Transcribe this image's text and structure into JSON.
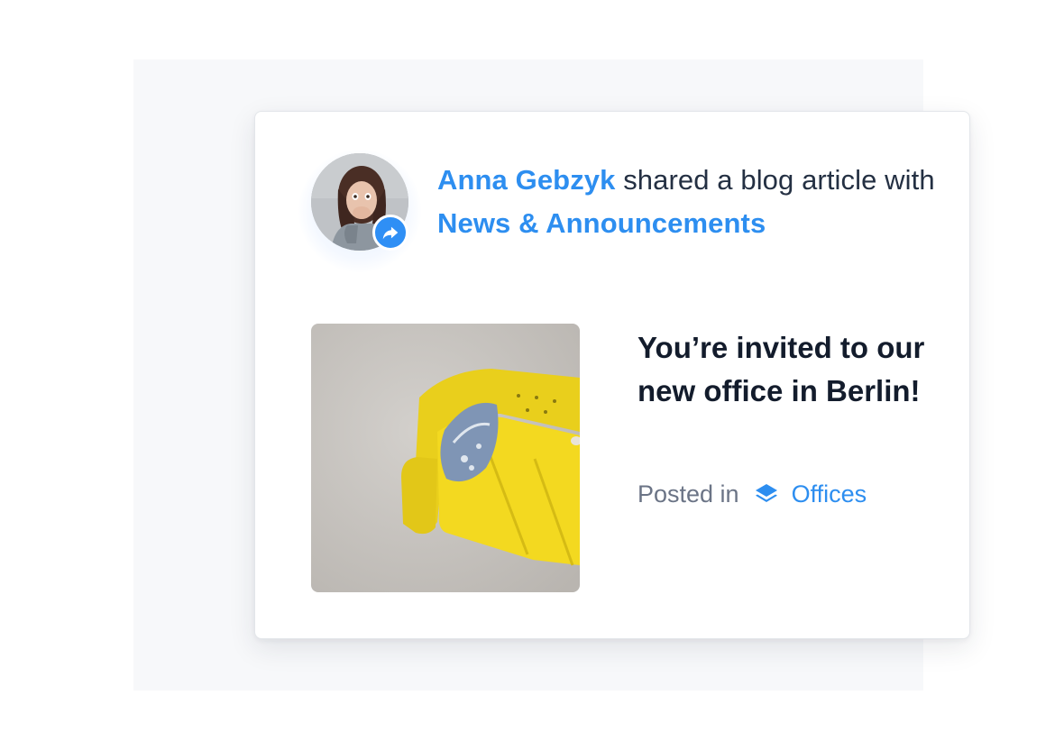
{
  "activity": {
    "actor_name": "Anna Gebzyk",
    "action_text": " shared a blog article with ",
    "target_space": "News & Announcements",
    "badge_icon": "share-arrow-icon",
    "accent_color": "#2d8ef0"
  },
  "post": {
    "title": "You’re invited to our new office in Berlin!",
    "posted_in_label": "Posted in",
    "space_icon": "layers-icon",
    "space_name": "Offices"
  }
}
